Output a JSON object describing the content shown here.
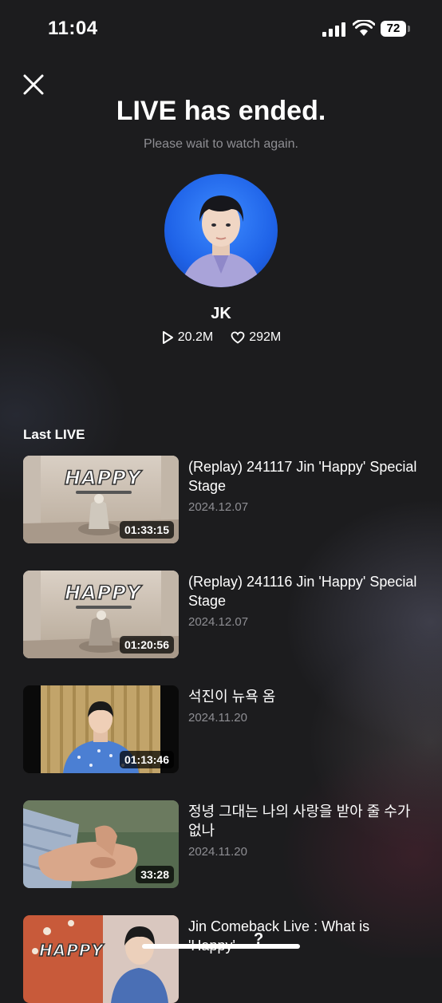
{
  "status_bar": {
    "time": "11:04",
    "battery": "72"
  },
  "header": {
    "title": "LIVE has ended.",
    "subtitle": "Please wait to watch again."
  },
  "profile": {
    "name": "JK",
    "plays": "20.2M",
    "likes": "292M"
  },
  "section_label": "Last LIVE",
  "videos": [
    {
      "title": "(Replay) 241117 Jin 'Happy' Special Stage",
      "date": "2024.12.07",
      "duration": "01:33:15",
      "thumb": "happy-stage"
    },
    {
      "title": "(Replay) 241116 Jin 'Happy' Special Stage",
      "date": "2024.12.07",
      "duration": "01:20:56",
      "thumb": "happy-stage"
    },
    {
      "title": "석진이 뉴욕 옴",
      "date": "2024.11.20",
      "duration": "01:13:46",
      "thumb": "curtain-room"
    },
    {
      "title": "정녕 그대는 나의 사랑을 받아 줄 수가 없나",
      "date": "2024.11.20",
      "duration": "33:28",
      "thumb": "hand-closeup"
    },
    {
      "title": "Jin Comeback Live : What is 'Happy'",
      "date": "",
      "duration": "",
      "thumb": "happy-poster"
    }
  ],
  "overlay": {
    "help_glyph": "?"
  },
  "colors": {
    "background": "#1c1c1e",
    "secondary_text": "#8e8e93",
    "avatar_bg": "#1f63e8"
  }
}
